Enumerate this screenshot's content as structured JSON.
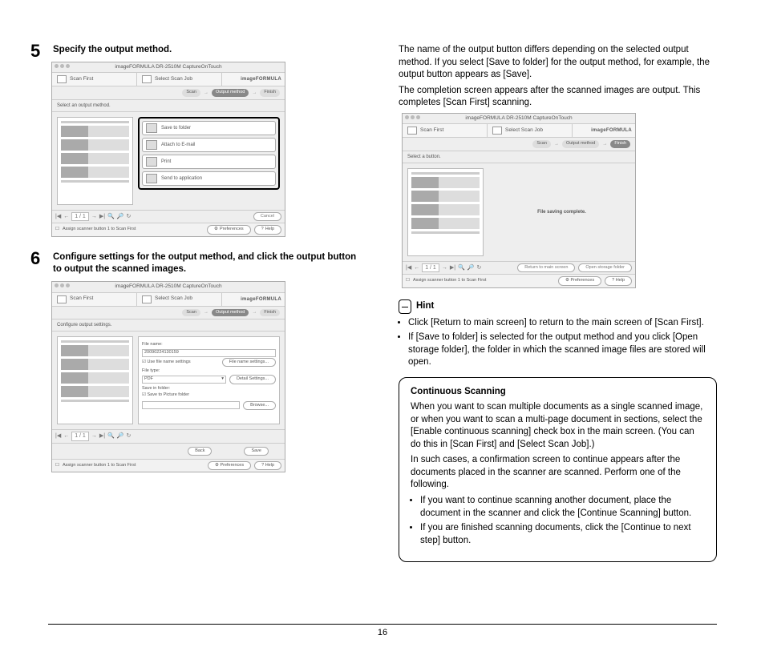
{
  "page_number": "16",
  "steps": {
    "s5": {
      "num": "5",
      "title": "Specify the output method."
    },
    "s6": {
      "num": "6",
      "title": "Configure settings for the output method, and click the output button to output the scanned images."
    }
  },
  "right_intro": {
    "p1": "The name of the output button differs depending on the selected output method. If you select [Save to folder] for the output method, for example, the output button appears as [Save].",
    "p2": "The completion screen appears after the scanned images are output. This completes [Scan First] scanning."
  },
  "hint": {
    "title": "Hint",
    "b1": "Click [Return to main screen] to return to the main screen of [Scan First].",
    "b2": "If [Save to folder] is selected for the output method and you click [Open storage folder], the folder in which the scanned image files are stored will open."
  },
  "cs": {
    "title": "Continuous Scanning",
    "p1": "When you want to scan multiple documents as a single scanned image, or when you want to scan a multi-page document in sections, select the [Enable continuous scanning] check box in the main screen. (You can do this in [Scan First] and [Select Scan Job].)",
    "p2": "In such cases, a confirmation screen to continue appears after the documents placed in the scanner are scanned. Perform one of the following.",
    "b1": "If you want to continue scanning another document, place the document in the scanner and click the [Continue Scanning] button.",
    "b2": "If you are finished scanning documents, click the [Continue to next step] button."
  },
  "app": {
    "title": "imageFORMULA DR-2510M CaptureOnTouch",
    "tab1": "Scan First",
    "tab2": "Select Scan Job",
    "logo": "imageFORMULA",
    "steps": {
      "scan": "Scan",
      "output": "Output method",
      "finish": "Finish"
    },
    "subhead1": "Select an output method.",
    "subhead2": "Configure output settings.",
    "subhead3": "Select a button.",
    "options": {
      "save": "Save to folder",
      "email": "Attach to E-mail",
      "print": "Print",
      "send": "Send to application"
    },
    "form": {
      "fname_lbl": "File name:",
      "fname_val": "20090224130159",
      "use_chk": "Use file name settings",
      "fname_btn": "File name settings...",
      "ftype_lbl": "File type:",
      "ftype_val": "PDF",
      "detail_btn": "Detail Settings...",
      "savein_lbl": "Save in folder:",
      "savein_chk": "Save to Picture folder",
      "browse_btn": "Browse..."
    },
    "nav": {
      "cancel": "Cancel",
      "back": "Back",
      "save": "Save"
    },
    "complete": "File saving complete.",
    "result_btns": {
      "ret": "Return to main screen",
      "open": "Open storage folder"
    },
    "foot": {
      "assign": "Assign scanner button 1 to Scan First",
      "pref": "Preferences",
      "help": "Help"
    }
  }
}
